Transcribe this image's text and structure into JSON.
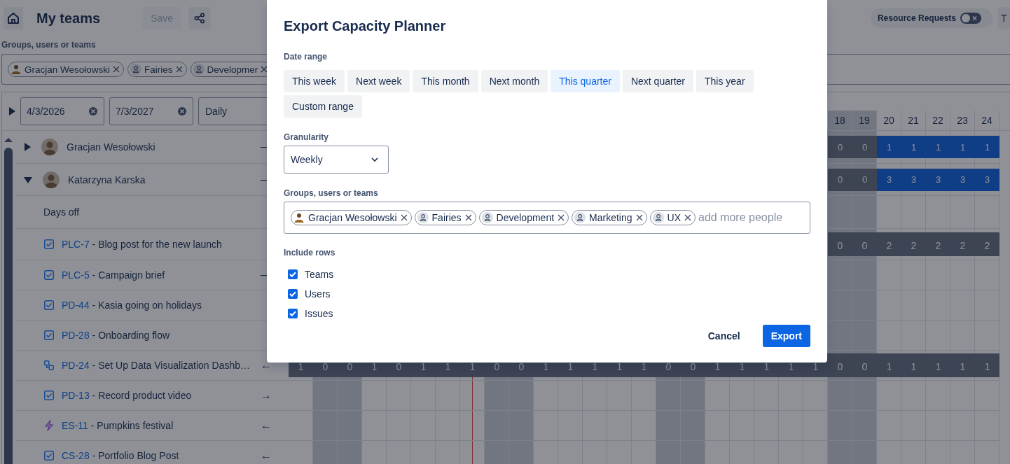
{
  "app": {
    "title": "My teams",
    "save_button": {
      "label": "Save",
      "disabled": true
    },
    "resource_requests": {
      "label": "Resource Requests",
      "on": false
    },
    "edge_button": {
      "label": "T"
    },
    "filter": {
      "label": "Groups, users or teams",
      "chips": [
        {
          "kind": "user",
          "label": "Gracjan Wesołowski"
        },
        {
          "kind": "group",
          "label": "Fairies"
        },
        {
          "kind": "group",
          "label": "Developmer"
        }
      ]
    },
    "planner": {
      "expanded": false,
      "start_date": "4/3/2026",
      "end_date": "7/3/2027",
      "view": "Daily",
      "columns": [
        {
          "weekend": false,
          "today": false
        },
        {
          "weekend": true,
          "today": false
        },
        {
          "weekend": true,
          "today": false
        },
        {
          "weekend": false,
          "today": false
        },
        {
          "weekend": false,
          "today": false
        },
        {
          "weekend": false,
          "today": false
        },
        {
          "weekend": false,
          "today": false
        },
        {
          "weekend": false,
          "today": true
        },
        {
          "weekend": true,
          "today": false
        },
        {
          "weekend": true,
          "today": false
        },
        {
          "weekend": false,
          "today": false
        },
        {
          "weekend": false,
          "today": false
        },
        {
          "weekend": false,
          "today": false
        },
        {
          "weekend": false,
          "today": false
        },
        {
          "weekend": false,
          "today": false
        },
        {
          "weekend": true,
          "today": false
        },
        {
          "weekend": true,
          "today": false
        },
        {
          "weekend": false,
          "today": false
        },
        {
          "weekend": false,
          "today": false
        },
        {
          "weekend": false,
          "today": false
        },
        {
          "weekend": false,
          "today": false
        },
        {
          "weekend": false,
          "today": false
        },
        {
          "label": "18",
          "weekend": true,
          "today": false
        },
        {
          "label": "19",
          "weekend": true,
          "today": false
        },
        {
          "label": "20",
          "weekend": false,
          "today": false
        },
        {
          "label": "21",
          "weekend": false,
          "today": false
        },
        {
          "label": "22",
          "weekend": false,
          "today": false
        },
        {
          "label": "23",
          "weekend": false,
          "today": false
        },
        {
          "label": "24",
          "weekend": false,
          "today": false
        }
      ],
      "rows": [
        {
          "kind": "user",
          "name": "Gracjan Wesołowski",
          "expanded": false,
          "trailing": "–",
          "cells": [
            null,
            null,
            null,
            null,
            null,
            null,
            null,
            null,
            null,
            null,
            null,
            null,
            null,
            null,
            null,
            null,
            null,
            null,
            null,
            null,
            null,
            null,
            {
              "value": "0",
              "kind": "weekend"
            },
            {
              "value": "0",
              "kind": "weekend"
            },
            {
              "value": "1",
              "kind": "capacity"
            },
            {
              "value": "1",
              "kind": "capacity"
            },
            {
              "value": "1",
              "kind": "capacity"
            },
            {
              "value": "1",
              "kind": "capacity"
            },
            {
              "value": "1",
              "kind": "capacity"
            }
          ]
        },
        {
          "kind": "user",
          "name": "Katarzyna Karska",
          "expanded": true,
          "trailing": "–",
          "cells": [
            null,
            null,
            null,
            null,
            null,
            null,
            null,
            null,
            null,
            null,
            null,
            null,
            null,
            null,
            null,
            null,
            null,
            null,
            null,
            null,
            null,
            null,
            {
              "value": "0",
              "kind": "weekend"
            },
            {
              "value": "0",
              "kind": "weekend"
            },
            {
              "value": "3",
              "kind": "capacity"
            },
            {
              "value": "3",
              "kind": "capacity"
            },
            {
              "value": "3",
              "kind": "capacity"
            },
            {
              "value": "3",
              "kind": "capacity"
            },
            {
              "value": "3",
              "kind": "capacity"
            }
          ]
        },
        {
          "kind": "section",
          "name": "Days off"
        },
        {
          "kind": "task",
          "key": "PLC-7",
          "title": "- Blog post for the new launch",
          "cells": [
            null,
            null,
            null,
            null,
            null,
            null,
            null,
            null,
            null,
            null,
            null,
            null,
            null,
            null,
            null,
            null,
            null,
            null,
            null,
            null,
            null,
            null,
            {
              "value": "0",
              "kind": "task"
            },
            {
              "value": "0",
              "kind": "task"
            },
            {
              "value": "2",
              "kind": "task"
            },
            {
              "value": "2",
              "kind": "task"
            },
            {
              "value": "2",
              "kind": "task"
            },
            {
              "value": "2",
              "kind": "task"
            },
            {
              "value": "2",
              "kind": "task"
            }
          ]
        },
        {
          "kind": "task",
          "key": "PLC-5",
          "title": "- Campaign brief",
          "trailing": "–"
        },
        {
          "kind": "task",
          "key": "PD-44",
          "title": "- Kasia going on holidays"
        },
        {
          "kind": "task",
          "key": "PD-28",
          "title": "- Onboarding flow"
        },
        {
          "kind": "subtask",
          "key": "PD-24",
          "title": "- Set Up Data Visualization Dashb…",
          "trailing": "←",
          "cells": [
            {
              "value": "1",
              "kind": "task"
            },
            {
              "value": "0",
              "kind": "task"
            },
            {
              "value": "0",
              "kind": "task"
            },
            {
              "value": "1",
              "kind": "task"
            },
            {
              "value": "0",
              "kind": "task"
            },
            {
              "value": "1",
              "kind": "task"
            },
            {
              "value": "1",
              "kind": "task"
            },
            {
              "value": "1",
              "kind": "task"
            },
            {
              "value": "0",
              "kind": "task"
            },
            {
              "value": "0",
              "kind": "task"
            },
            {
              "value": "1",
              "kind": "task"
            },
            {
              "value": "1",
              "kind": "task"
            },
            {
              "value": "1",
              "kind": "task"
            },
            {
              "value": "1",
              "kind": "task"
            },
            {
              "value": "1",
              "kind": "task"
            },
            {
              "value": "0",
              "kind": "task"
            },
            {
              "value": "0",
              "kind": "task"
            },
            {
              "value": "1",
              "kind": "task"
            },
            {
              "value": "1",
              "kind": "task"
            },
            {
              "value": "1",
              "kind": "task"
            },
            {
              "value": "1",
              "kind": "task"
            },
            {
              "value": "1",
              "kind": "task"
            },
            {
              "value": "0",
              "kind": "task"
            },
            {
              "value": "0",
              "kind": "task"
            },
            {
              "value": "1",
              "kind": "task"
            },
            {
              "value": "1",
              "kind": "task"
            },
            {
              "value": "1",
              "kind": "task"
            },
            {
              "value": "1",
              "kind": "task"
            },
            {
              "value": "1",
              "kind": "task"
            }
          ]
        },
        {
          "kind": "task",
          "key": "PD-13",
          "title": "- Record product video",
          "trailing": "→"
        },
        {
          "kind": "epic",
          "key": "ES-11",
          "title": "- Pumpkins festival",
          "trailing": "←"
        },
        {
          "kind": "task",
          "key": "CS-28",
          "title": "- Portfolio Blog Post",
          "trailing": "←"
        }
      ]
    }
  },
  "dialog": {
    "title": "Export Capacity Planner",
    "date_range": {
      "label": "Date range",
      "options": [
        {
          "label": "This week",
          "selected": false
        },
        {
          "label": "Next week",
          "selected": false
        },
        {
          "label": "This month",
          "selected": false
        },
        {
          "label": "Next month",
          "selected": false
        },
        {
          "label": "This quarter",
          "selected": true
        },
        {
          "label": "Next quarter",
          "selected": false
        },
        {
          "label": "This year",
          "selected": false
        },
        {
          "label": "Custom range",
          "selected": false
        }
      ]
    },
    "granularity": {
      "label": "Granularity",
      "value": "Weekly"
    },
    "people": {
      "label": "Groups, users or teams",
      "placeholder": "add more people",
      "chips": [
        {
          "kind": "user",
          "label": "Gracjan Wesołowski"
        },
        {
          "kind": "group",
          "label": "Fairies"
        },
        {
          "kind": "group",
          "label": "Development"
        },
        {
          "kind": "group",
          "label": "Marketing"
        },
        {
          "kind": "group",
          "label": "UX"
        }
      ]
    },
    "include_rows": {
      "label": "Include rows",
      "options": [
        {
          "label": "Teams",
          "checked": true
        },
        {
          "label": "Users",
          "checked": true
        },
        {
          "label": "Issues",
          "checked": true
        }
      ]
    },
    "buttons": [
      {
        "kind": "text",
        "label": "Cancel"
      },
      {
        "kind": "primary",
        "label": "Export"
      }
    ]
  }
}
